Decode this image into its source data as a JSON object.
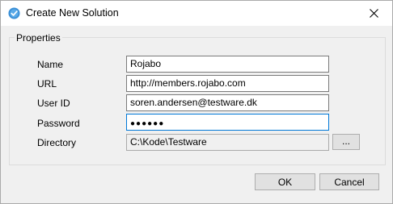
{
  "window": {
    "title": "Create New Solution",
    "app_icon": "check-badge-icon",
    "close_icon": "close-icon"
  },
  "properties": {
    "legend": "Properties",
    "name_label": "Name",
    "name_value": "Rojabo",
    "url_label": "URL",
    "url_value": "http://members.rojabo.com",
    "userid_label": "User ID",
    "userid_value": "soren.andersen@testware.dk",
    "password_label": "Password",
    "password_masked": "●●●●●●",
    "directory_label": "Directory",
    "directory_value": "C:\\Kode\\Testware",
    "browse_label": "..."
  },
  "buttons": {
    "ok_label": "OK",
    "cancel_label": "Cancel"
  },
  "colors": {
    "accent": "#0078d7",
    "icon_fill": "#3a8fd6",
    "dialog_background": "#f0f0f0"
  }
}
